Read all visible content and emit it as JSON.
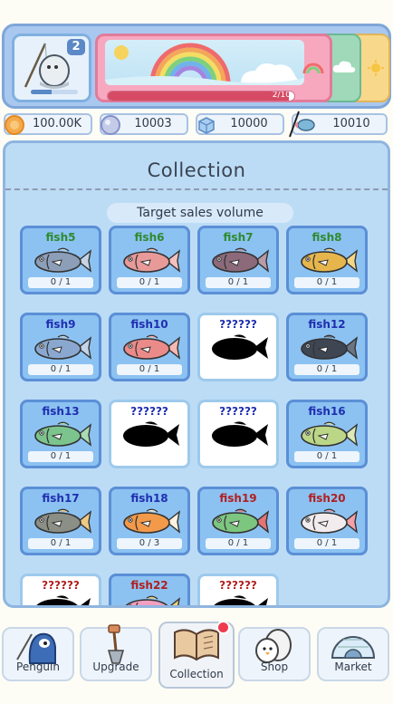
{
  "player": {
    "level": "2",
    "xp_fraction": 0.45
  },
  "stage": {
    "progress_label": "2/10",
    "progress_fraction": 0.97
  },
  "currencies": [
    {
      "icon": "coin-icon",
      "value": "100.00K"
    },
    {
      "icon": "pearl-icon",
      "value": "10003"
    },
    {
      "icon": "ice-cube-icon",
      "value": "10000"
    },
    {
      "icon": "rod-fish-icon",
      "value": "10010"
    }
  ],
  "collection": {
    "title": "Collection",
    "subtitle": "Target sales volume",
    "cards": [
      {
        "name": "fish5",
        "count": "0 / 1",
        "known": true,
        "name_color": "#2f8a2f",
        "body": "#8c9eb8",
        "fin": "#c6d3e3"
      },
      {
        "name": "fish6",
        "count": "0 / 1",
        "known": true,
        "name_color": "#2f8a2f",
        "body": "#e89a99",
        "fin": "#f4c1be"
      },
      {
        "name": "fish7",
        "count": "0 / 1",
        "known": true,
        "name_color": "#2f8a2f",
        "body": "#8c6a7a",
        "fin": "#b99aa7"
      },
      {
        "name": "fish8",
        "count": "0 / 1",
        "known": true,
        "name_color": "#2f8a2f",
        "body": "#e6b64d",
        "fin": "#f3d789"
      },
      {
        "name": "fish9",
        "count": "0 / 1",
        "known": true,
        "name_color": "#1f2fb0",
        "body": "#8aa8cf",
        "fin": "#c4d5ea"
      },
      {
        "name": "fish10",
        "count": "0 / 1",
        "known": true,
        "name_color": "#1f2fb0",
        "body": "#ea8b8a",
        "fin": "#f5b9b3"
      },
      {
        "name": "??????",
        "count": "",
        "known": false,
        "name_color": "#1f2fb0"
      },
      {
        "name": "fish12",
        "count": "0 / 1",
        "known": true,
        "name_color": "#1f2fb0",
        "body": "#3e4654",
        "fin": "#6b7483"
      },
      {
        "name": "fish13",
        "count": "0 / 1",
        "known": true,
        "name_color": "#1f2fb0",
        "body": "#7cc48d",
        "fin": "#a9dcb2"
      },
      {
        "name": "??????",
        "count": "",
        "known": false,
        "name_color": "#1f2fb0"
      },
      {
        "name": "??????",
        "count": "",
        "known": false,
        "name_color": "#1f2fb0"
      },
      {
        "name": "fish16",
        "count": "0 / 1",
        "known": true,
        "name_color": "#1f2fb0",
        "body": "#bcd688",
        "fin": "#dbe9b7"
      },
      {
        "name": "fish17",
        "count": "0 / 1",
        "known": true,
        "name_color": "#1f2fb0",
        "body": "#8b8f86",
        "fin": "#f0c982"
      },
      {
        "name": "fish18",
        "count": "0 / 3",
        "known": true,
        "name_color": "#1f2fb0",
        "body": "#f29a4a",
        "fin": "#fff2e0"
      },
      {
        "name": "fish19",
        "count": "0 / 1",
        "known": true,
        "name_color": "#b02020",
        "body": "#7dc680",
        "fin": "#e57474"
      },
      {
        "name": "fish20",
        "count": "0 / 1",
        "known": true,
        "name_color": "#b02020",
        "body": "#f3ecee",
        "fin": "#f3a0a8"
      },
      {
        "name": "??????",
        "count": "",
        "known": false,
        "name_color": "#b02020"
      },
      {
        "name": "fish22",
        "count": "",
        "known": true,
        "name_color": "#b02020",
        "body": "#f0a0c0",
        "fin": "#f6d27a"
      },
      {
        "name": "??????",
        "count": "",
        "known": false,
        "name_color": "#b02020"
      }
    ]
  },
  "nav": {
    "items": [
      {
        "label": "Penguin"
      },
      {
        "label": "Upgrade"
      },
      {
        "label": "Collection"
      },
      {
        "label": "Shop"
      },
      {
        "label": "Market"
      }
    ]
  }
}
